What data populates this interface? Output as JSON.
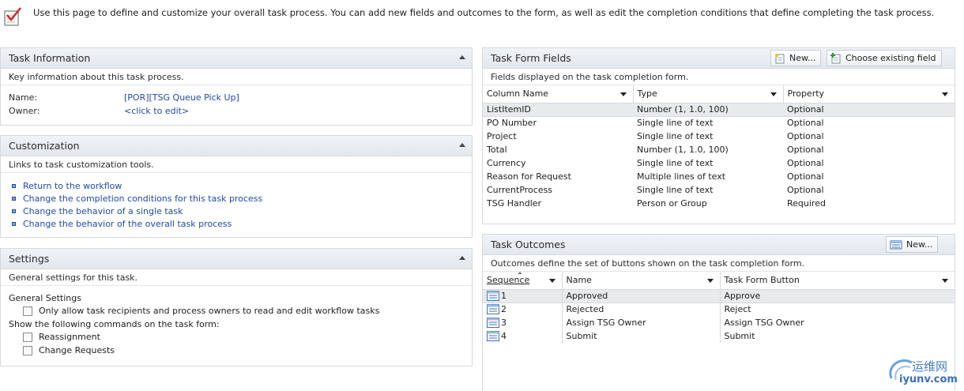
{
  "intro": {
    "text": "Use this page to define and customize your overall task process. You can add new fields and outcomes to the form, as well as edit the completion conditions that define completing the task process."
  },
  "task_information": {
    "title": "Task Information",
    "description": "Key information about this task process.",
    "name_label": "Name:",
    "name_value": "[POR][TSG Queue Pick Up]",
    "owner_label": "Owner:",
    "owner_value": "<click to edit>"
  },
  "customization": {
    "title": "Customization",
    "description": "Links to task customization tools.",
    "links": [
      "Return to the workflow",
      "Change the completion conditions for this task process",
      "Change the behavior of a single task",
      "Change the behavior of the overall task process"
    ]
  },
  "settings": {
    "title": "Settings",
    "description": "General settings for this task.",
    "general_label": "General Settings",
    "option_permissions": "Only allow task recipients and process owners to read and edit workflow tasks",
    "commands_label": "Show the following commands on the task form:",
    "option_reassignment": "Reassignment",
    "option_change_requests": "Change Requests",
    "checked": {
      "permissions": false,
      "reassignment": false,
      "change_requests": false
    }
  },
  "task_form_fields": {
    "title": "Task Form Fields",
    "new_button": "New...",
    "choose_existing_button": "Choose existing field",
    "description": "Fields displayed on the task completion form.",
    "columns": [
      "Column Name",
      "Type",
      "Property"
    ],
    "rows": [
      [
        "ListItemID",
        "Number (1, 1.0, 100)",
        "Optional"
      ],
      [
        "PO Number",
        "Single line of text",
        "Optional"
      ],
      [
        "Project",
        "Single line of text",
        "Optional"
      ],
      [
        "Total",
        "Number (1, 1.0, 100)",
        "Optional"
      ],
      [
        "Currency",
        "Single line of text",
        "Optional"
      ],
      [
        "Reason for Request",
        "Multiple lines of text",
        "Optional"
      ],
      [
        "CurrentProcess",
        "Single line of text",
        "Optional"
      ],
      [
        "TSG Handler",
        "Person or Group",
        "Required"
      ]
    ],
    "selected_row": 0
  },
  "task_outcomes": {
    "title": "Task Outcomes",
    "new_button": "New...",
    "description": "Outcomes define the set of buttons shown on the task completion form.",
    "columns": [
      "Sequence",
      "Name",
      "Task Form Button"
    ],
    "rows": [
      [
        "1",
        "Approved",
        "Approve"
      ],
      [
        "2",
        "Rejected",
        "Reject"
      ],
      [
        "3",
        "Assign TSG Owner",
        "Assign TSG Owner"
      ],
      [
        "4",
        "Submit",
        "Submit"
      ]
    ],
    "selected_row": 0
  },
  "watermark": {
    "cn": "运维网",
    "en": "iyunv.com"
  },
  "colors": {
    "link": "#1f4aa5",
    "panel_header": "#e3e8ee",
    "border": "#d5d9de",
    "selection": "#e9eaec"
  }
}
